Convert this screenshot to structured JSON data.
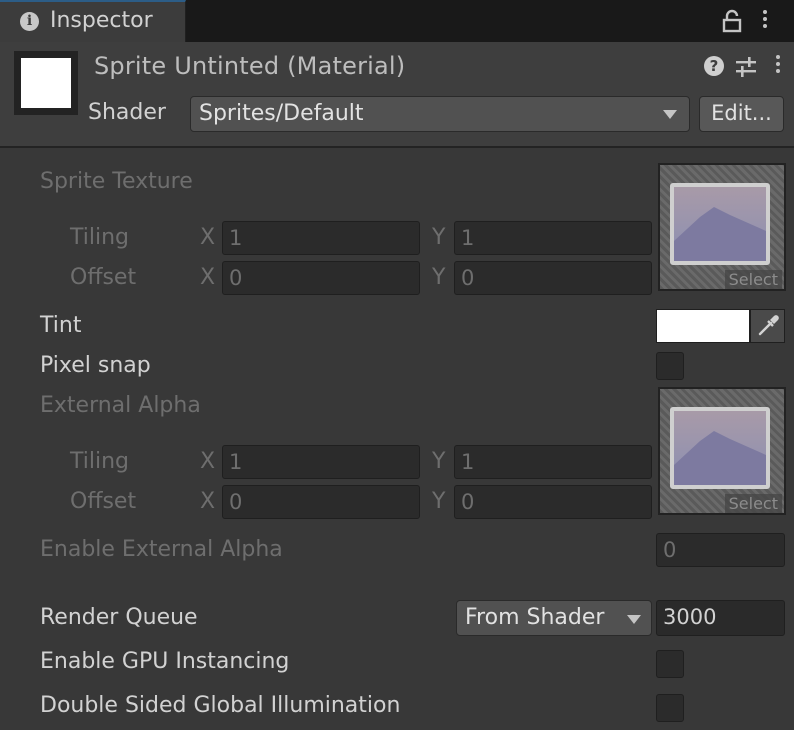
{
  "tab": {
    "title": "Inspector"
  },
  "header": {
    "material_title": "Sprite Untinted (Material)",
    "shader_label": "Shader",
    "shader_value": "Sprites/Default",
    "edit_label": "Edit..."
  },
  "sprite_texture": {
    "label": "Sprite Texture",
    "tiling_label": "Tiling",
    "offset_label": "Offset",
    "tiling_x": "1",
    "tiling_y": "1",
    "offset_x": "0",
    "offset_y": "0",
    "select_label": "Select"
  },
  "axes": {
    "x": "X",
    "y": "Y"
  },
  "tint": {
    "label": "Tint",
    "color": "#ffffff"
  },
  "pixel_snap": {
    "label": "Pixel snap",
    "checked": false
  },
  "external_alpha": {
    "label": "External Alpha",
    "tiling_label": "Tiling",
    "offset_label": "Offset",
    "tiling_x": "1",
    "tiling_y": "1",
    "offset_x": "0",
    "offset_y": "0",
    "select_label": "Select"
  },
  "enable_external_alpha": {
    "label": "Enable External Alpha",
    "value": "0"
  },
  "render_queue": {
    "label": "Render Queue",
    "mode": "From Shader",
    "value": "3000"
  },
  "gpu_instancing": {
    "label": "Enable GPU Instancing",
    "checked": false
  },
  "double_sided_gi": {
    "label": "Double Sided Global Illumination",
    "checked": false
  },
  "colors": {
    "panel": "#383838",
    "tabbar": "#191919",
    "field": "#2b2b2b",
    "accent": "#2c5d87"
  }
}
